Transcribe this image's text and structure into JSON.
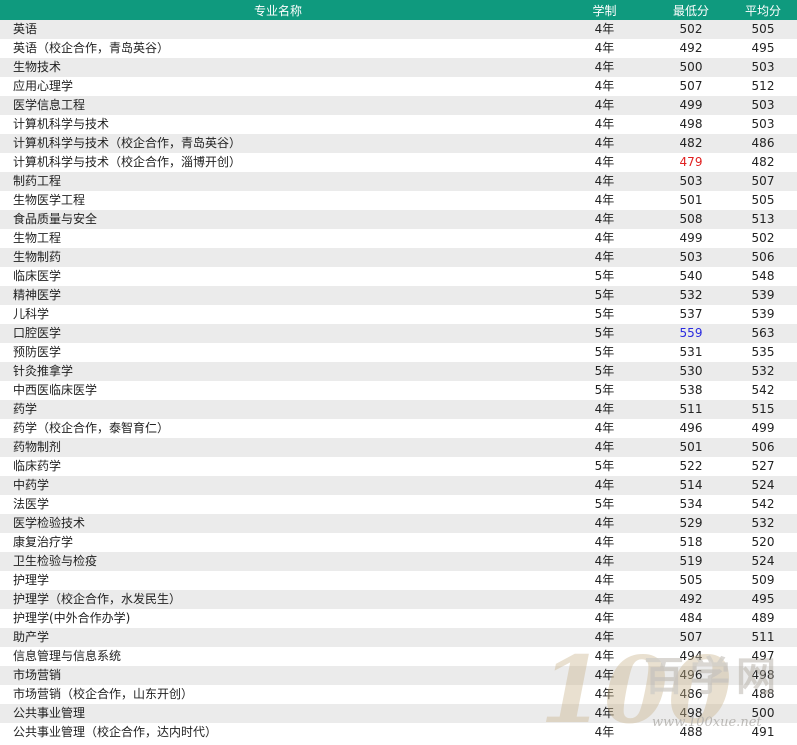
{
  "table": {
    "headers": [
      "专业名称",
      "学制",
      "最低分",
      "平均分"
    ],
    "rows": [
      {
        "name": "英语",
        "years": "4年",
        "min": "502",
        "avg": "505"
      },
      {
        "name": "英语（校企合作，青岛英谷）",
        "years": "4年",
        "min": "492",
        "avg": "495"
      },
      {
        "name": "生物技术",
        "years": "4年",
        "min": "500",
        "avg": "503"
      },
      {
        "name": "应用心理学",
        "years": "4年",
        "min": "507",
        "avg": "512"
      },
      {
        "name": "医学信息工程",
        "years": "4年",
        "min": "499",
        "avg": "503"
      },
      {
        "name": "计算机科学与技术",
        "years": "4年",
        "min": "498",
        "avg": "503"
      },
      {
        "name": "计算机科学与技术（校企合作，青岛英谷）",
        "years": "4年",
        "min": "482",
        "avg": "486"
      },
      {
        "name": "计算机科学与技术（校企合作，淄博开创）",
        "years": "4年",
        "min": "479",
        "avg": "482",
        "min_color": "#e02020"
      },
      {
        "name": "制药工程",
        "years": "4年",
        "min": "503",
        "avg": "507"
      },
      {
        "name": "生物医学工程",
        "years": "4年",
        "min": "501",
        "avg": "505"
      },
      {
        "name": "食品质量与安全",
        "years": "4年",
        "min": "508",
        "avg": "513"
      },
      {
        "name": "生物工程",
        "years": "4年",
        "min": "499",
        "avg": "502"
      },
      {
        "name": "生物制药",
        "years": "4年",
        "min": "503",
        "avg": "506"
      },
      {
        "name": "临床医学",
        "years": "5年",
        "min": "540",
        "avg": "548"
      },
      {
        "name": "精神医学",
        "years": "5年",
        "min": "532",
        "avg": "539"
      },
      {
        "name": "儿科学",
        "years": "5年",
        "min": "537",
        "avg": "539"
      },
      {
        "name": "口腔医学",
        "years": "5年",
        "min": "559",
        "avg": "563",
        "min_color": "#2a2ae0"
      },
      {
        "name": "预防医学",
        "years": "5年",
        "min": "531",
        "avg": "535"
      },
      {
        "name": "针灸推拿学",
        "years": "5年",
        "min": "530",
        "avg": "532"
      },
      {
        "name": "中西医临床医学",
        "years": "5年",
        "min": "538",
        "avg": "542"
      },
      {
        "name": "药学",
        "years": "4年",
        "min": "511",
        "avg": "515"
      },
      {
        "name": "药学（校企合作，泰智育仁）",
        "years": "4年",
        "min": "496",
        "avg": "499"
      },
      {
        "name": "药物制剂",
        "years": "4年",
        "min": "501",
        "avg": "506"
      },
      {
        "name": "临床药学",
        "years": "5年",
        "min": "522",
        "avg": "527"
      },
      {
        "name": "中药学",
        "years": "4年",
        "min": "514",
        "avg": "524"
      },
      {
        "name": "法医学",
        "years": "5年",
        "min": "534",
        "avg": "542"
      },
      {
        "name": "医学检验技术",
        "years": "4年",
        "min": "529",
        "avg": "532"
      },
      {
        "name": "康复治疗学",
        "years": "4年",
        "min": "518",
        "avg": "520"
      },
      {
        "name": "卫生检验与检疫",
        "years": "4年",
        "min": "519",
        "avg": "524"
      },
      {
        "name": "护理学",
        "years": "4年",
        "min": "505",
        "avg": "509"
      },
      {
        "name": "护理学（校企合作，水发民生）",
        "years": "4年",
        "min": "492",
        "avg": "495"
      },
      {
        "name": "护理学(中外合作办学)",
        "years": "4年",
        "min": "484",
        "avg": "489"
      },
      {
        "name": "助产学",
        "years": "4年",
        "min": "507",
        "avg": "511"
      },
      {
        "name": "信息管理与信息系统",
        "years": "4年",
        "min": "494",
        "avg": "497"
      },
      {
        "name": "市场营销",
        "years": "4年",
        "min": "496",
        "avg": "498"
      },
      {
        "name": "市场营销（校企合作，山东开创）",
        "years": "4年",
        "min": "486",
        "avg": "488"
      },
      {
        "name": "公共事业管理",
        "years": "4年",
        "min": "498",
        "avg": "500"
      },
      {
        "name": "公共事业管理（校企合作，达内时代）",
        "years": "4年",
        "min": "488",
        "avg": "491"
      }
    ]
  },
  "watermark": {
    "logo_text": "100",
    "brand_text": "百学网",
    "url_text": "www.100xue.net"
  },
  "colors": {
    "header_bg": "#0f9a7e",
    "row_stripe": "#ebebeb"
  }
}
